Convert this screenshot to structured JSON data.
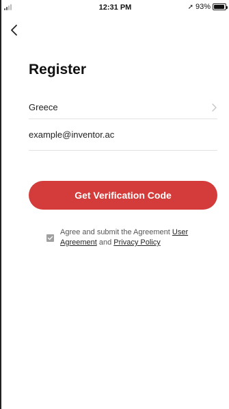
{
  "status_bar": {
    "time": "12:31 PM",
    "battery_percent": "93%",
    "battery_level": 0.93
  },
  "header": {
    "back_icon": "chevron-left-icon"
  },
  "page": {
    "title": "Register"
  },
  "form": {
    "country_value": "Greece",
    "email_value": "example@inventor.ac"
  },
  "actions": {
    "verify_label": "Get Verification Code",
    "accent_color": "#d33c3a"
  },
  "agreement": {
    "checked": true,
    "prefix": "Agree and submit the Agreement ",
    "user_agreement_link": "User Agreement",
    "and_text": " and ",
    "privacy_link": "Privacy Policy"
  }
}
